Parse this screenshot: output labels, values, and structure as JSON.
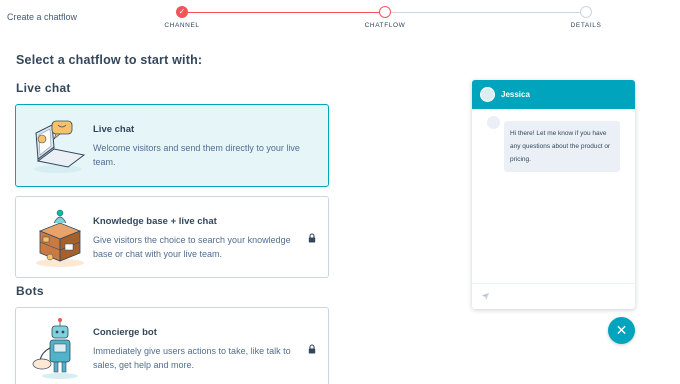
{
  "topbar": {
    "breadcrumb": "Create a chatflow",
    "steps": [
      {
        "label": "CHANNEL",
        "state": "complete",
        "check": "✓"
      },
      {
        "label": "CHATFLOW",
        "state": "current"
      },
      {
        "label": "DETAILS",
        "state": "upcoming"
      }
    ]
  },
  "main": {
    "heading": "Select a chatflow to start with:",
    "sections": {
      "live_chat": "Live chat",
      "bots": "Bots"
    },
    "cards": [
      {
        "title": "Live chat",
        "description": "Welcome visitors and send them directly to your live team.",
        "selected": true,
        "locked": false,
        "icon": "laptop-chat-illustration"
      },
      {
        "title": "Knowledge base + live chat",
        "description": "Give visitors the choice to search your knowledge base or chat with your live team.",
        "selected": false,
        "locked": true,
        "icon": "book-stack-illustration"
      },
      {
        "title": "Concierge bot",
        "description": "Immediately give users actions to take, like talk to sales, get help and more.",
        "selected": false,
        "locked": true,
        "icon": "robot-illustration"
      }
    ]
  },
  "preview": {
    "agent_name": "Jessica",
    "message": "Hi there! Let me know if you have any questions about the product or pricing.",
    "close_glyph": "✕"
  },
  "colors": {
    "accent": "#00a4bd",
    "progress": "#f2545b",
    "selected_bg": "#e5f5f8",
    "text": "#33475b"
  }
}
